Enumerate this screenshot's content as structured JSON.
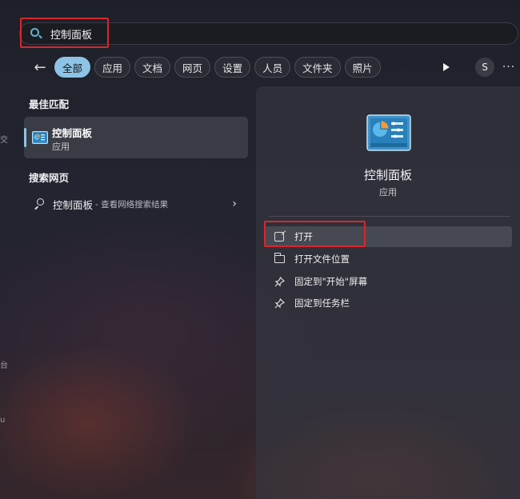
{
  "search": {
    "value": "控制面板",
    "placeholder": "控制面板"
  },
  "filters": {
    "back_icon": "arrow-left-icon",
    "chips": [
      {
        "label": "全部",
        "active": true
      },
      {
        "label": "应用",
        "active": false
      },
      {
        "label": "文档",
        "active": false
      },
      {
        "label": "网页",
        "active": false
      },
      {
        "label": "设置",
        "active": false
      },
      {
        "label": "人员",
        "active": false
      },
      {
        "label": "文件夹",
        "active": false
      },
      {
        "label": "照片",
        "active": false
      }
    ],
    "avatar_letter": "S",
    "more_label": "···"
  },
  "best_match": {
    "section_title": "最佳匹配",
    "name": "控制面板",
    "type": "应用"
  },
  "web": {
    "section_title": "搜索网页",
    "query": "控制面板",
    "hint": "- 查看网络搜索结果",
    "chevron": "›"
  },
  "detail": {
    "name": "控制面板",
    "type": "应用",
    "actions": [
      {
        "label": "打开",
        "icon": "external-link-icon"
      },
      {
        "label": "打开文件位置",
        "icon": "folder-icon"
      },
      {
        "label": "固定到\"开始\"屏幕",
        "icon": "pin-icon"
      },
      {
        "label": "固定到任务栏",
        "icon": "pin-icon"
      }
    ]
  },
  "edge_glyphs": [
    "交",
    "台",
    "u"
  ],
  "colors": {
    "accent": "#8dc4e6",
    "highlight_box": "#d9262c",
    "search_icon": "#5fb3c9"
  }
}
